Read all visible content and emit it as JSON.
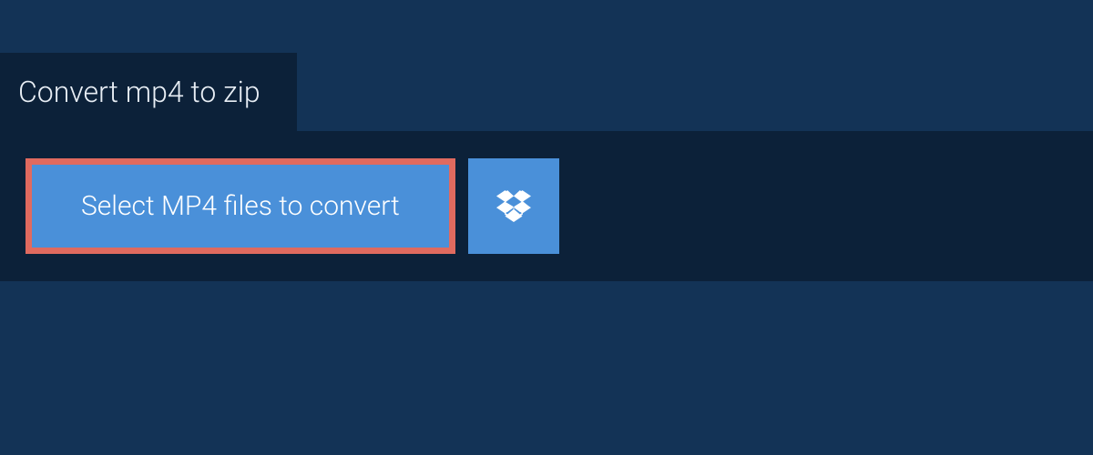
{
  "header": {
    "title": "Convert mp4 to zip"
  },
  "actions": {
    "select_label": "Select MP4 files to convert",
    "dropbox_icon": "dropbox-icon"
  }
}
